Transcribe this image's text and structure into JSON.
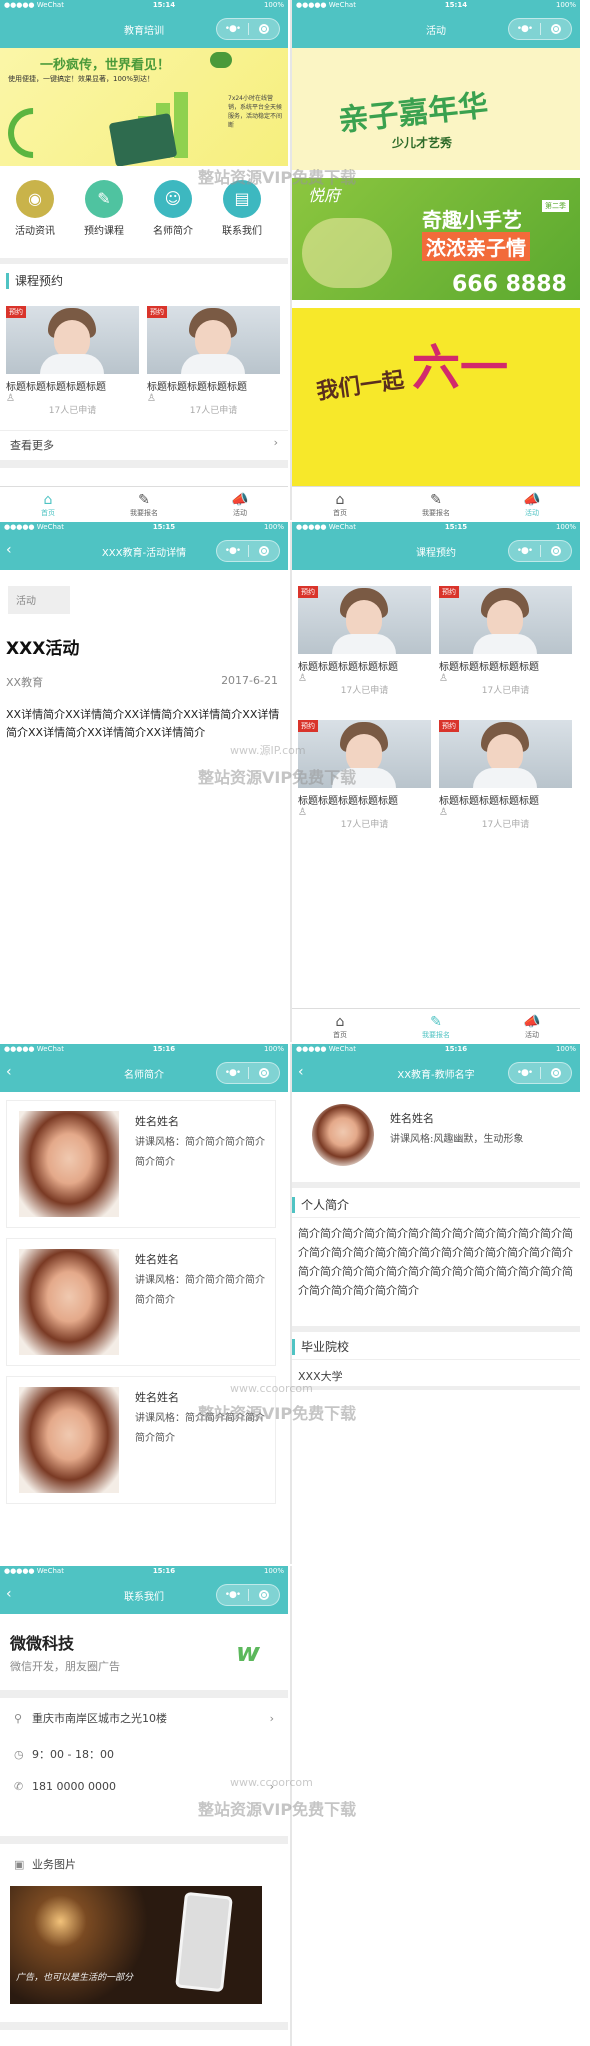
{
  "status": {
    "carrier": "●●●●● WeChat",
    "battery": "100%",
    "time_a": "15:14",
    "time_b": "15:15",
    "time_c": "15:16"
  },
  "screen1": {
    "title": "教育培训",
    "banner_headline": "一秒疯传，世界看见！",
    "banner_sub": "使用便捷，一键搞定！效果显著，100%到达！",
    "banner_note": "7x24小时在线营销，系统平台全天候服务，活动稳定不间断",
    "icons": [
      {
        "label": "活动资讯",
        "color": "#c9b34a"
      },
      {
        "label": "预约课程",
        "color": "#4fc3a0"
      },
      {
        "label": "名师简介",
        "color": "#3db8c0"
      },
      {
        "label": "联系我们",
        "color": "#3db8c0"
      }
    ],
    "section": "课程预约",
    "cards": [
      {
        "tag": "预约",
        "title": "标题标题标题标题标题",
        "count": "17人已申请"
      },
      {
        "tag": "预约",
        "title": "标题标题标题标题标题",
        "count": "17人已申请"
      }
    ],
    "more": "查看更多"
  },
  "screen2": {
    "title": "活动",
    "banner1_text": "亲子嘉年华",
    "banner1_sub": "少儿才艺秀",
    "banner2_title": "奇趣小手艺",
    "banner2_title2": "浓浓亲子情",
    "banner2_brand": "悦府",
    "banner2_phone": "666 8888",
    "banner2_badge": "第二季",
    "banner3_text": "我们一起",
    "banner3_big": "六一"
  },
  "screen3": {
    "title": "XXX教育-活动详情",
    "tag": "活动",
    "heading": "XXX活动",
    "org": "XX教育",
    "date": "2017-6-21",
    "body": "XX详情简介XX详情简介XX详情简介XX详情简介XX详情简介XX详情简介XX详情简介XX详情简介"
  },
  "screen4": {
    "title": "课程预约",
    "cards": [
      {
        "tag": "预约",
        "title": "标题标题标题标题标题",
        "count": "17人已申请"
      },
      {
        "tag": "预约",
        "title": "标题标题标题标题标题",
        "count": "17人已申请"
      },
      {
        "tag": "预约",
        "title": "标题标题标题标题标题",
        "count": "17人已申请"
      },
      {
        "tag": "预约",
        "title": "标题标题标题标题标题",
        "count": "17人已申请"
      }
    ]
  },
  "screen5": {
    "title": "名师简介",
    "teachers": [
      {
        "name": "姓名姓名",
        "style": "讲课风格：简介简介简介简介简介简介"
      },
      {
        "name": "姓名姓名",
        "style": "讲课风格：简介简介简介简介简介简介"
      },
      {
        "name": "姓名姓名",
        "style": "讲课风格：简介简介简介简介简介简介"
      }
    ]
  },
  "screen6": {
    "title": "XX教育-教师名字",
    "name": "姓名姓名",
    "style": "讲课风格:风趣幽默，生动形象",
    "sec1": "个人简介",
    "intro": "简介简介简介简介简介简介简介简介简介简介简介简介简介简介简介简介简介简介简介简介简介简介简介简介简介简介简介简介简介简介简介简介简介简介简介简介简介简介简介简介简介简介简介",
    "sec2": "毕业院校",
    "school": "XXX大学"
  },
  "screen7": {
    "title": "联系我们",
    "company": "微微科技",
    "slogan": "微信开发，朋友圈广告",
    "address": "重庆市南岸区城市之光10楼",
    "hours": "9：00 - 18：00",
    "phone": "181 0000 0000",
    "gallery_label": "业务图片",
    "photo_caption": "广告，也可以是生活的一部分"
  },
  "tabs": [
    {
      "label": "首页",
      "icon": "home-icon"
    },
    {
      "label": "我要报名",
      "icon": "pencil-icon"
    },
    {
      "label": "活动",
      "icon": "megaphone-icon"
    }
  ],
  "watermark": {
    "url": "www.ccoorcom",
    "text": "整站资源VIP免费下载",
    "url2": "www.源IP.com"
  }
}
